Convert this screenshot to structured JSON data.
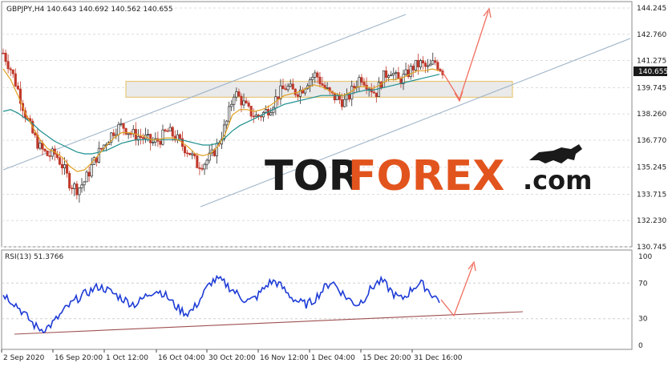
{
  "chart_data": [
    {
      "type": "candlestick",
      "symbol_header": "GBPJPY,H4  140.643 140.692 140.562 140.655",
      "y_ticks": [
        "144.245",
        "142.760",
        "141.275",
        "139.745",
        "138.260",
        "136.770",
        "135.245",
        "133.715",
        "132.230",
        "130.745"
      ],
      "y_tick_values": [
        144.245,
        142.76,
        141.275,
        139.745,
        138.26,
        136.77,
        135.245,
        133.715,
        132.23,
        130.745
      ],
      "ylim": [
        130.745,
        144.245
      ],
      "current_price": "140.655",
      "close_path": [
        141.7,
        140.8,
        139.6,
        138.2,
        137.1,
        136.3,
        135.9,
        136.0,
        135.3,
        134.3,
        134.0,
        134.5,
        135.4,
        136.2,
        136.8,
        137.4,
        137.6,
        137.2,
        137.0,
        136.9,
        136.6,
        136.8,
        137.3,
        137.0,
        136.5,
        136.1,
        135.4,
        135.5,
        135.9,
        136.7,
        137.8,
        139.5,
        139.0,
        138.4,
        138.1,
        138.3,
        138.7,
        139.4,
        139.8,
        139.5,
        139.6,
        140.2,
        140.5,
        139.8,
        139.3,
        139.1,
        138.9,
        139.7,
        140.4,
        139.9,
        139.4,
        140.3,
        140.8,
        140.1,
        140.4,
        140.9,
        141.1,
        140.8,
        141.2,
        140.7
      ],
      "ma_fast_path": [
        140.8,
        140.2,
        139.3,
        138.3,
        137.5,
        136.8,
        136.3,
        136.1,
        135.8,
        135.3,
        135.0,
        135.1,
        135.5,
        136.0,
        136.5,
        136.9,
        137.2,
        137.2,
        137.1,
        137.0,
        136.8,
        136.8,
        136.9,
        136.9,
        136.7,
        136.4,
        136.0,
        135.9,
        136.0,
        136.4,
        137.1,
        138.2,
        138.5,
        138.5,
        138.4,
        138.5,
        138.7,
        139.0,
        139.3,
        139.4,
        139.5,
        139.7,
        139.9,
        139.8,
        139.6,
        139.4,
        139.3,
        139.5,
        139.8,
        139.8,
        139.7,
        139.9,
        140.2,
        140.2,
        140.3,
        140.5,
        140.7,
        140.7,
        140.8,
        140.7
      ],
      "ma_slow_path": [
        138.4,
        138.5,
        138.3,
        138.0,
        137.7,
        137.3,
        137.0,
        136.7,
        136.5,
        136.3,
        136.1,
        136.0,
        136.0,
        136.1,
        136.2,
        136.4,
        136.6,
        136.7,
        136.8,
        136.8,
        136.8,
        136.8,
        136.8,
        136.8,
        136.8,
        136.7,
        136.6,
        136.5,
        136.5,
        136.6,
        136.9,
        137.3,
        137.6,
        137.8,
        138.0,
        138.2,
        138.4,
        138.6,
        138.8,
        138.9,
        139.0,
        139.1,
        139.2,
        139.3,
        139.3,
        139.3,
        139.3,
        139.4,
        139.5,
        139.6,
        139.6,
        139.7,
        139.8,
        139.9,
        140.0,
        140.1,
        140.2,
        140.3,
        140.4,
        140.5
      ],
      "resistance_zone": [
        139.2,
        140.1
      ]
    },
    {
      "type": "line",
      "header": "RSI(13) 51.3766",
      "y_ticks": [
        "100",
        "70",
        "30",
        "0"
      ],
      "y_tick_values": [
        100,
        70,
        30,
        0
      ],
      "ylim": [
        0,
        100
      ],
      "values": [
        58,
        52,
        46,
        38,
        30,
        22,
        18,
        20,
        26,
        34,
        42,
        48,
        54,
        58,
        62,
        66,
        64,
        60,
        56,
        52,
        48,
        46,
        52,
        58,
        62,
        60,
        54,
        46,
        40,
        36,
        40,
        50,
        62,
        72,
        74,
        70,
        64,
        58,
        52,
        50,
        54,
        62,
        70,
        72,
        66,
        58,
        52,
        48,
        46,
        50,
        58,
        66,
        72,
        64,
        56,
        50,
        46,
        52,
        62,
        70,
        72,
        64,
        56,
        52,
        58,
        66,
        70,
        64,
        56,
        51
      ]
    }
  ],
  "x_ticks": [
    "2 Sep 2020",
    "16 Sep 20:00",
    "1 Oct 12:00",
    "16 Oct 04:00",
    "30 Oct 20:00",
    "16 Nov 12:00",
    "1 Dec 04:00",
    "15 Dec 20:00",
    "31 Dec 16:00"
  ],
  "logo": {
    "part1": "TOR",
    "part2": "FOREX",
    "part3": ".com"
  },
  "colors": {
    "bull_candle": "#2b2b2b",
    "bear_candle": "#c0392b",
    "ma_fast": "#e0a020",
    "ma_slow": "#1f8f8f",
    "channel": "#9fb4c8",
    "arrow": "#f07060",
    "rsi": "#1e3cd6",
    "rsi_trend": "#a05050",
    "zone_fill": "#e8e8e8",
    "zone_stroke": "#e6c36a",
    "price_label_bg": "#1a1a1a"
  }
}
